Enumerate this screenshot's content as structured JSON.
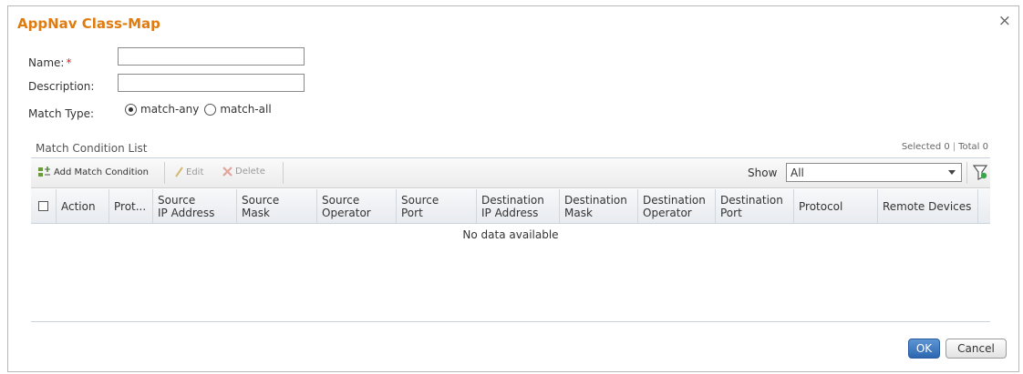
{
  "dialog": {
    "title": "AppNav Class-Map",
    "close_glyph": "×"
  },
  "form": {
    "name_label": "Name:",
    "required_mark": "*",
    "name_value": "",
    "description_label": "Description:",
    "description_value": "",
    "match_type_label": "Match Type:",
    "match_type_options": [
      {
        "label": "match-any",
        "selected": true
      },
      {
        "label": "match-all",
        "selected": false
      }
    ]
  },
  "list": {
    "title": "Match Condition List",
    "selected_text": "Selected 0",
    "separator": "|",
    "total_text": "Total 0",
    "toolbar": {
      "add_label": "Add Match Condition",
      "edit_label": "Edit",
      "delete_label": "Delete",
      "show_label": "Show",
      "show_value": "All"
    },
    "columns": [
      {
        "line1": "Action",
        "line2": ""
      },
      {
        "line1": "Prot...",
        "line2": ""
      },
      {
        "line1": "Source",
        "line2": "IP Address"
      },
      {
        "line1": "Source",
        "line2": "Mask"
      },
      {
        "line1": "Source",
        "line2": "Operator"
      },
      {
        "line1": "Source",
        "line2": "Port"
      },
      {
        "line1": "Destination",
        "line2": "IP Address"
      },
      {
        "line1": "Destination",
        "line2": "Mask"
      },
      {
        "line1": "Destination",
        "line2": "Operator"
      },
      {
        "line1": "Destination",
        "line2": "Port"
      },
      {
        "line1": "Protocol",
        "line2": ""
      },
      {
        "line1": "Remote Devices",
        "line2": ""
      }
    ],
    "empty_message": "No data available"
  },
  "buttons": {
    "ok_label": "OK",
    "cancel_label": "Cancel"
  },
  "colors": {
    "title": "#e07b10",
    "required": "#e21a1a",
    "primary_button": "#2c67b0"
  }
}
